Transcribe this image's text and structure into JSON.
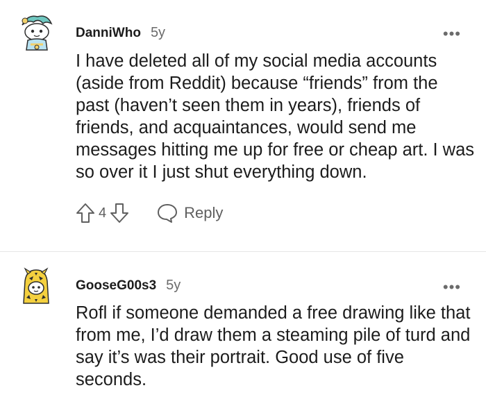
{
  "comments": [
    {
      "username": "DanniWho",
      "age": "5y",
      "more": "•••",
      "text": "I have deleted all of my social media accounts (aside from Reddit) because “friends” from the past (haven’t seen them in years), friends of friends, and acquaintances, would send me messages hitting me up for free or cheap art. I was so over it I just shut everything down.",
      "votes": "4",
      "reply_label": "Reply",
      "icons": {
        "avatar": "avatar-snoo-teal-hair",
        "upvote": "arrow-up-icon",
        "downvote": "arrow-down-icon",
        "reply": "speech-bubble-icon"
      }
    },
    {
      "username": "GooseG00s3",
      "age": "5y",
      "more": "•••",
      "text": "Rofl if someone demanded a free drawing like that from me, I’d draw them a steaming pile of turd and say it’s was their portrait. Good use of five seconds.",
      "icons": {
        "avatar": "avatar-snoo-yellow-hood"
      }
    }
  ],
  "colors": {
    "text": "#1c1c1c",
    "meta": "#6b6b6b",
    "divider": "#e6e6e6"
  }
}
